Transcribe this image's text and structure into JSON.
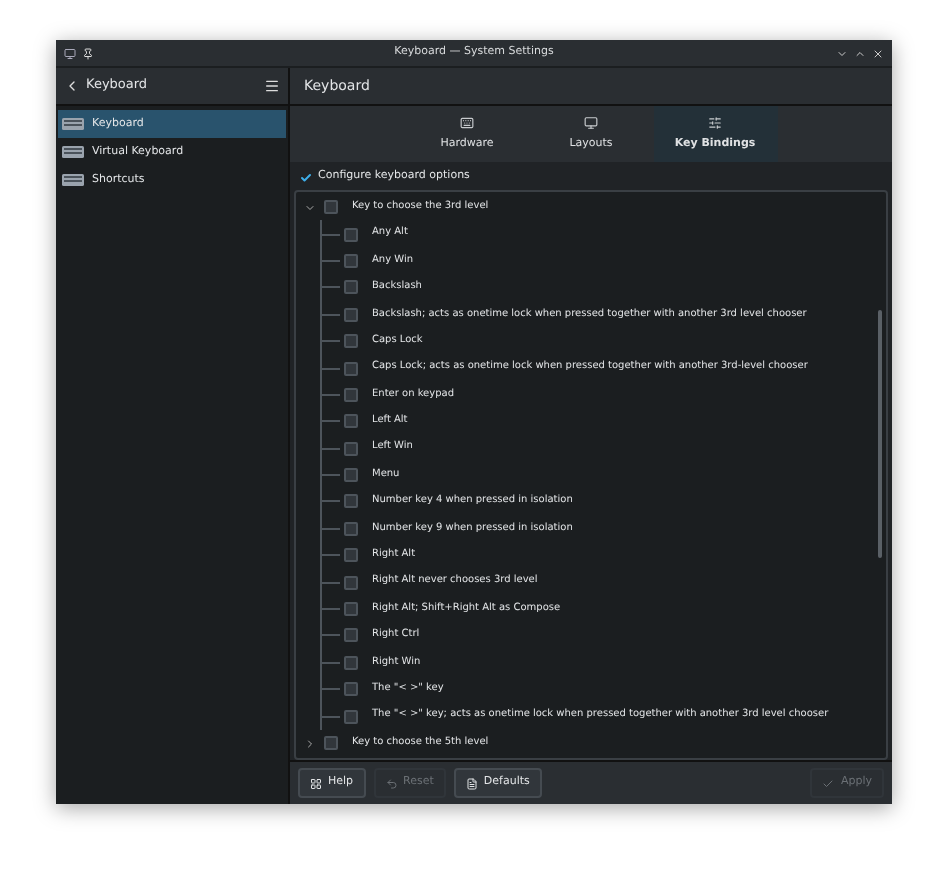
{
  "window": {
    "title": "Keyboard — System Settings"
  },
  "sidebar": {
    "title": "Keyboard",
    "items": [
      {
        "label": "Keyboard",
        "selected": true
      },
      {
        "label": "Virtual Keyboard",
        "selected": false
      },
      {
        "label": "Shortcuts",
        "selected": false
      }
    ]
  },
  "page_title": "Keyboard",
  "tabs": [
    {
      "label": "Hardware",
      "selected": false,
      "kind": "hardware"
    },
    {
      "label": "Layouts",
      "selected": false,
      "kind": "layouts"
    },
    {
      "label": "Key Bindings",
      "selected": true,
      "kind": "bindings"
    }
  ],
  "configure": {
    "label": "Configure keyboard options",
    "checked": true
  },
  "options": [
    {
      "label": "Key to choose the 3rd level",
      "checked": false,
      "expanded": true,
      "children": [
        {
          "label": "Any Alt",
          "checked": false
        },
        {
          "label": "Any Win",
          "checked": false
        },
        {
          "label": "Backslash",
          "checked": false
        },
        {
          "label": "Backslash; acts as onetime lock when pressed together with another 3rd level chooser",
          "checked": false
        },
        {
          "label": "Caps Lock",
          "checked": false
        },
        {
          "label": "Caps Lock; acts as onetime lock when pressed together with another 3rd-level chooser",
          "checked": false
        },
        {
          "label": "Enter on keypad",
          "checked": false
        },
        {
          "label": "Left Alt",
          "checked": false
        },
        {
          "label": "Left Win",
          "checked": false
        },
        {
          "label": "Menu",
          "checked": false
        },
        {
          "label": "Number key 4 when pressed in isolation",
          "checked": false
        },
        {
          "label": "Number key 9 when pressed in isolation",
          "checked": false
        },
        {
          "label": "Right Alt",
          "checked": false
        },
        {
          "label": "Right Alt never chooses 3rd level",
          "checked": false
        },
        {
          "label": "Right Alt; Shift+Right Alt as Compose",
          "checked": false
        },
        {
          "label": "Right Ctrl",
          "checked": false
        },
        {
          "label": "Right Win",
          "checked": false
        },
        {
          "label": "The \"< >\" key",
          "checked": false
        },
        {
          "label": "The \"< >\" key; acts as onetime lock when pressed together with another 3rd level chooser",
          "checked": false
        }
      ]
    },
    {
      "label": "Key to choose the 5th level",
      "checked": false,
      "expanded": false
    }
  ],
  "buttons": [
    {
      "label": "Help",
      "kind": "help",
      "disabled": false
    },
    {
      "label": "Reset",
      "kind": "reset",
      "disabled": true
    },
    {
      "label": "Defaults",
      "kind": "defaults",
      "disabled": false
    },
    {
      "label": "Apply",
      "kind": "apply",
      "disabled": true
    }
  ]
}
